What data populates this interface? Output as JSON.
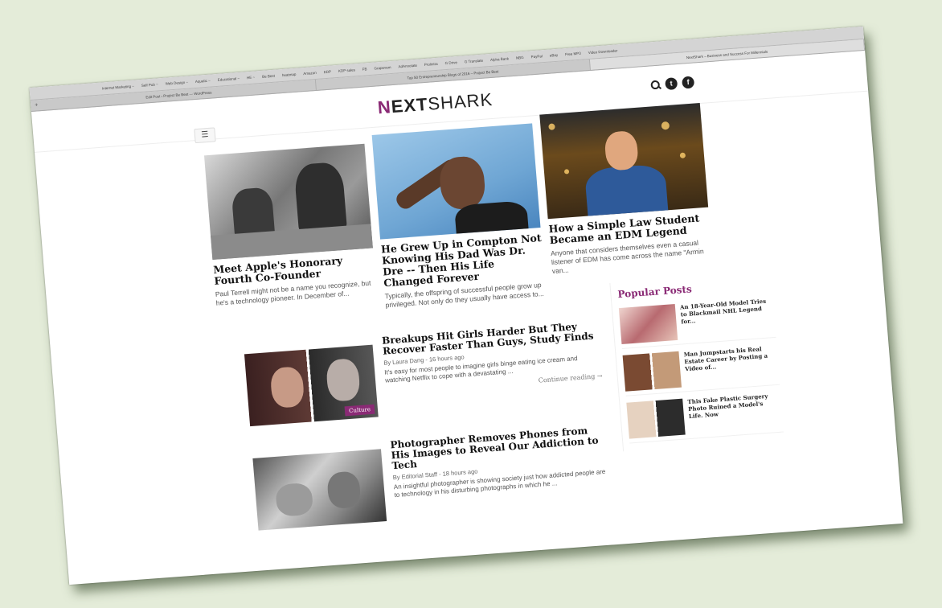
{
  "browser": {
    "bookmarks": [
      "Internet Marketing ~",
      "Self Pub ~",
      "Web Design ~",
      "Aquatic ~",
      "Educational ~",
      "HE ~",
      "Be Best",
      "heatmap",
      "Amazon",
      "KDP",
      "KDP sales",
      "FB",
      "Grapevem",
      "AdAnnotate",
      "Prolintra",
      "G Drive",
      "G Translate",
      "Alpha Bank",
      "NBG",
      "PayPal",
      "eBay",
      "Free MP3",
      "Video Downloader"
    ],
    "tabs": [
      "Edit Post ‹ Project Be Best — WordPress",
      "Top 50 Entrepreneurship Blogs of 2016 – Project Be Best",
      "NextShark – Business and Success For Millennials"
    ],
    "active_tab": 2,
    "new_tab_label": "+"
  },
  "site": {
    "logo_n": "N",
    "logo_ext": "EXT",
    "logo_shark": "SHARK",
    "menu_icon": "hamburger-icon",
    "search_icon": "search-icon",
    "social": [
      {
        "icon": "twitter-icon",
        "glyph": "t"
      },
      {
        "icon": "facebook-icon",
        "glyph": "f"
      }
    ],
    "accent": "#8a2a75"
  },
  "top_stories": [
    {
      "title": "Meet Apple's Honorary Fourth Co-Founder",
      "excerpt": "Paul Terrell might not be a name you recognize, but he's a technology pioneer. In December of..."
    },
    {
      "title": "He Grew Up in Compton Not Knowing His Dad Was Dr. Dre -- Then His Life Changed Forever",
      "excerpt": "Typically, the offspring of successful people grow up privileged. Not only do they usually have access to..."
    },
    {
      "title": "How a Simple Law Student Became an EDM Legend",
      "excerpt": "Anyone that considers themselves even a casual listener of EDM has come across the name \"Armin van..."
    }
  ],
  "feed": [
    {
      "title": "Breakups Hit Girls Harder But They Recover Faster Than Guys, Study Finds",
      "byline": "By Laura Dang - 16 hours ago",
      "excerpt": "It's easy for most people to imagine girls binge eating ice cream and watching Netflix to cope with a devastating ...",
      "more": "Continue reading →",
      "badge": "Culture"
    },
    {
      "title": "Photographer Removes Phones from His Images to Reveal Our Addiction to Tech",
      "byline": "By Editorial Staff - 18 hours ago",
      "excerpt": "An insightful photographer is showing society just how addicted people are to technology in his disturbing photographs in which he ..."
    }
  ],
  "sidebar": {
    "heading": "Popular Posts",
    "posts": [
      {
        "title": "An 18-Year-Old Model Tries to Blackmail NHL Legend for..."
      },
      {
        "title": "Man Jumpstarts his Real Estate Career by Posting a Video of..."
      },
      {
        "title": "This Fake Plastic Surgery Photo Ruined a Model's Life. Now"
      }
    ]
  }
}
